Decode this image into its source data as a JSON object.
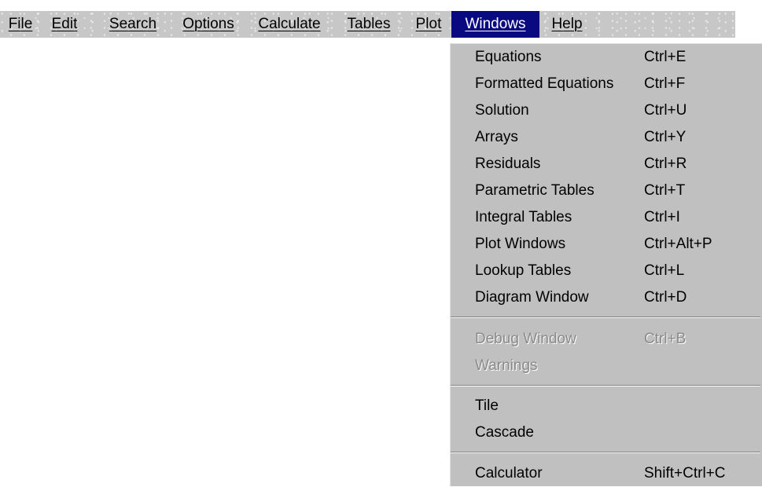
{
  "menubar": {
    "items": [
      {
        "label": "File"
      },
      {
        "label": "Edit"
      },
      {
        "label": "Search"
      },
      {
        "label": "Options"
      },
      {
        "label": "Calculate"
      },
      {
        "label": "Tables"
      },
      {
        "label": "Plot"
      },
      {
        "label": "Windows",
        "active": true
      },
      {
        "label": "Help"
      }
    ]
  },
  "windows_menu": {
    "group1": [
      {
        "label": "Equations",
        "shortcut": "Ctrl+E"
      },
      {
        "label": "Formatted Equations",
        "shortcut": "Ctrl+F"
      },
      {
        "label": "Solution",
        "shortcut": "Ctrl+U"
      },
      {
        "label": "Arrays",
        "shortcut": "Ctrl+Y"
      },
      {
        "label": "Residuals",
        "shortcut": "Ctrl+R"
      },
      {
        "label": "Parametric Tables",
        "shortcut": "Ctrl+T"
      },
      {
        "label": "Integral Tables",
        "shortcut": "Ctrl+I"
      },
      {
        "label": "Plot Windows",
        "shortcut": "Ctrl+Alt+P"
      },
      {
        "label": "Lookup Tables",
        "shortcut": "Ctrl+L"
      },
      {
        "label": "Diagram Window",
        "shortcut": "Ctrl+D"
      }
    ],
    "group2": [
      {
        "label": "Debug Window",
        "shortcut": "Ctrl+B",
        "disabled": true
      },
      {
        "label": "Warnings",
        "shortcut": "",
        "disabled": true
      }
    ],
    "group3": [
      {
        "label": "Tile",
        "shortcut": ""
      },
      {
        "label": "Cascade",
        "shortcut": ""
      }
    ],
    "group4": [
      {
        "label": "Calculator",
        "shortcut": "Shift+Ctrl+C"
      }
    ]
  },
  "colors": {
    "menubar_bg": "#c7c7c7",
    "highlight_bg": "#0a0a80",
    "highlight_text": "#ffffff",
    "menu_bg": "#c0c0c0",
    "disabled_text": "#8a8a8a"
  }
}
